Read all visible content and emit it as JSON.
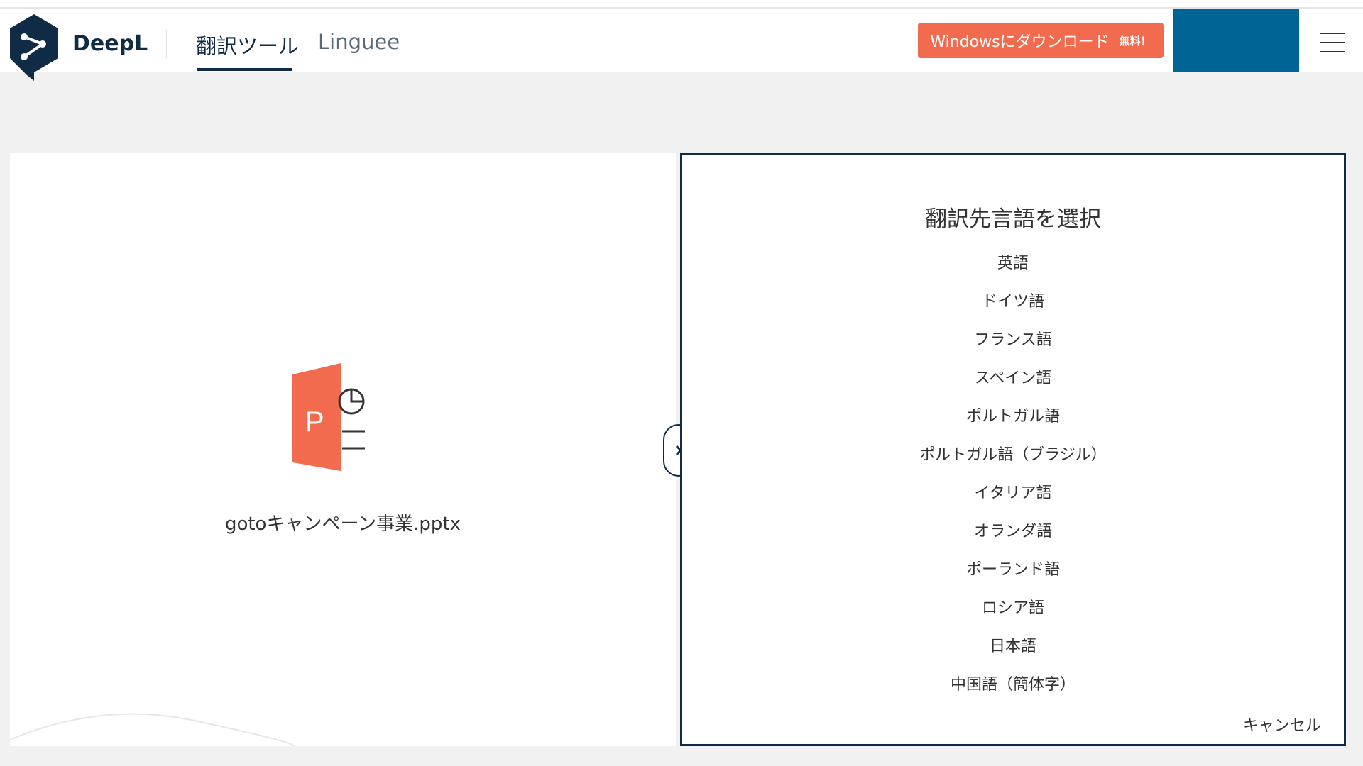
{
  "header": {
    "brand": "DeepL",
    "tabs": [
      {
        "label": "翻訳ツール",
        "active": true
      },
      {
        "label": "Linguee",
        "active": false
      }
    ],
    "download_button": {
      "label": "Windowsにダウンロード",
      "badge": "無料！"
    },
    "colors": {
      "brand_navy": "#0f2b46",
      "download_orange": "#f26b4f",
      "account_blue": "#006494"
    }
  },
  "source": {
    "file_icon": "powerpoint-file-icon",
    "file_letter": "P",
    "file_name": "gotoキャンペーン事業.pptx"
  },
  "toggle": {
    "icon": "chevron-right-icon"
  },
  "target": {
    "title": "翻訳先言語を選択",
    "languages": [
      "英語",
      "ドイツ語",
      "フランス語",
      "スペイン語",
      "ポルトガル語",
      "ポルトガル語（ブラジル）",
      "イタリア語",
      "オランダ語",
      "ポーランド語",
      "ロシア語",
      "日本語",
      "中国語（簡体字）"
    ],
    "cancel_label": "キャンセル"
  }
}
